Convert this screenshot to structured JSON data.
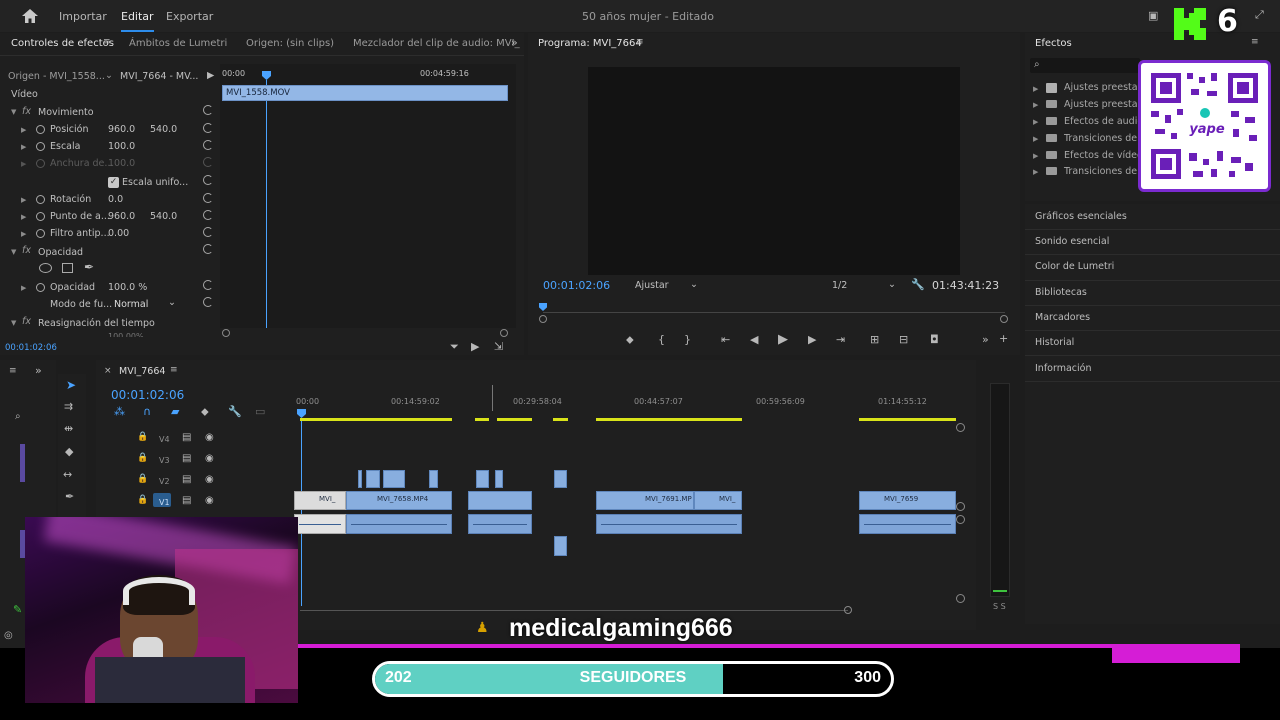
{
  "topbar": {
    "nav": [
      "Importar",
      "Editar",
      "Exportar"
    ],
    "project_title": "50 años mujer",
    "project_status": "- Editado"
  },
  "source_panel": {
    "tabs": [
      "Controles de efectos",
      "Ámbitos de Lumetri",
      "Origen: (sin clips)",
      "Mezclador del clip de audio: MVI_"
    ],
    "origin_label": "Origen - MVI_1558...",
    "sequence_label": "MVI_7664 - MV...",
    "ruler_start": "00:00",
    "ruler_end": "00:04:59:16",
    "clip_name": "MVI_1558.MOV",
    "video_section": "Vídeo",
    "motion": "Movimiento",
    "props": [
      {
        "name": "Posición",
        "v1": "960.0",
        "v2": "540.0"
      },
      {
        "name": "Escala",
        "v1": "100.0",
        "v2": ""
      },
      {
        "name": "Anchura de...",
        "v1": "100.0",
        "v2": ""
      },
      {
        "name": "Escala unifo...",
        "v1": "",
        "v2": ""
      },
      {
        "name": "Rotación",
        "v1": "0.0",
        "v2": ""
      },
      {
        "name": "Punto de a...",
        "v1": "960.0",
        "v2": "540.0"
      },
      {
        "name": "Filtro antip...",
        "v1": "0.00",
        "v2": ""
      }
    ],
    "opacity_section": "Opacidad",
    "opacity_label": "Opacidad",
    "opacity_value": "100.0 %",
    "blend_label": "Modo de fu...",
    "blend_value": "Normal",
    "time_remap": "Reasignación del tiempo",
    "speed_partial": "100.00%",
    "timecode": "00:01:02:06"
  },
  "program_monitor": {
    "title": "Programa: MVI_7664",
    "timecode": "00:01:02:06",
    "fit": "Ajustar",
    "resolution": "1/2",
    "duration": "01:43:41:23"
  },
  "timeline": {
    "sequence_name": "MVI_7664",
    "timecode": "00:01:02:06",
    "ruler": [
      "00:00",
      "00:14:59:02",
      "00:29:58:04",
      "00:44:57:07",
      "00:59:56:09",
      "01:14:55:12"
    ],
    "tracks": [
      "V4",
      "V3",
      "V2",
      "V1"
    ],
    "clips": [
      "MVI_",
      "MVI_7658.MP4",
      "MVI_7691.MP",
      "MVI_",
      "MVI_7659"
    ],
    "meter": "S S"
  },
  "effects_panel": {
    "title": "Efectos",
    "folders": [
      "Ajustes preestab",
      "Ajustes preestab",
      "Efectos de audio",
      "Transiciones de a",
      "Efectos de vídeo",
      "Transiciones de v"
    ],
    "links": [
      "Gráficos esenciales",
      "Sonido esencial",
      "Color de Lumetri",
      "Bibliotecas",
      "Marcadores",
      "Historial",
      "Información"
    ]
  },
  "overlay": {
    "username": "medicalgaming666",
    "followers_current": "202",
    "followers_label": "SEGUIDORES",
    "followers_goal": "300",
    "followers_progress": 0.674,
    "kick_counter": "6",
    "qr_brand": "yape"
  },
  "colors": {
    "accent_blue": "#4aa3ff",
    "clip_blue": "#88aedf",
    "in_out_yellow": "#d9e319",
    "overlay_magenta": "#d51dd6",
    "progress_teal": "#5fd0c3",
    "kick_green": "#53fc18"
  }
}
